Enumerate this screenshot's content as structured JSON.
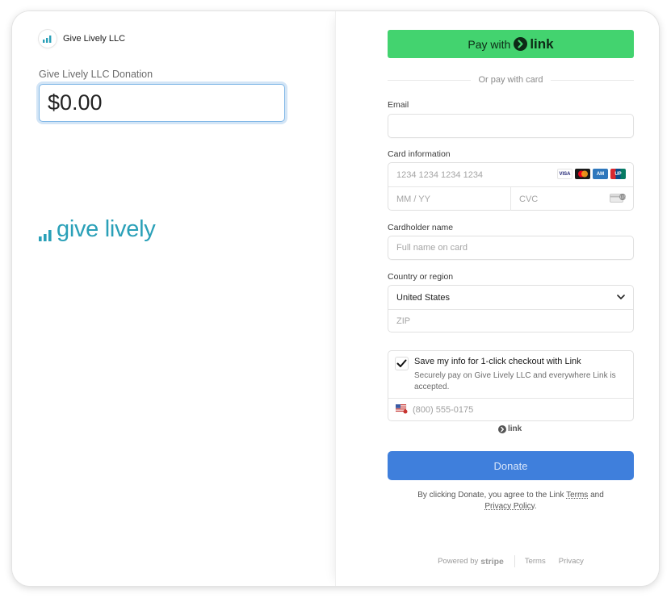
{
  "merchant": {
    "name": "Give Lively LLC"
  },
  "donation": {
    "label": "Give Lively LLC Donation",
    "amount": "$0.00"
  },
  "brand": {
    "text": "give lively",
    "color": "#2aa0b8"
  },
  "pay_link": {
    "label": "Pay with",
    "link_word": "link",
    "color": "#43d36f"
  },
  "divider": {
    "text": "Or pay with card"
  },
  "email": {
    "label": "Email",
    "placeholder": ""
  },
  "card": {
    "label": "Card information",
    "number_placeholder": "1234 1234 1234 1234",
    "exp_placeholder": "MM / YY",
    "cvc_placeholder": "CVC",
    "brands": [
      "visa-icon",
      "mastercard-icon",
      "amex-icon",
      "unionpay-icon"
    ]
  },
  "cardholder": {
    "label": "Cardholder name",
    "placeholder": "Full name on card"
  },
  "country": {
    "label": "Country or region",
    "selected": "United States",
    "zip_placeholder": "ZIP"
  },
  "save_info": {
    "title": "Save my info for 1-click checkout with Link",
    "description": "Securely pay on Give Lively LLC and everywhere Link is accepted.",
    "checked": true,
    "phone_placeholder": "(800) 555-0175"
  },
  "link_mini": {
    "text": "link"
  },
  "donate": {
    "label": "Donate",
    "color": "#3f7fdc"
  },
  "terms": {
    "prefix": "By clicking Donate, you agree to the Link ",
    "terms_link": "Terms",
    "middle": " and",
    "privacy_link": "Privacy Policy",
    "suffix": "."
  },
  "footer": {
    "powered_by": "Powered by",
    "stripe": "stripe",
    "terms": "Terms",
    "privacy": "Privacy"
  }
}
